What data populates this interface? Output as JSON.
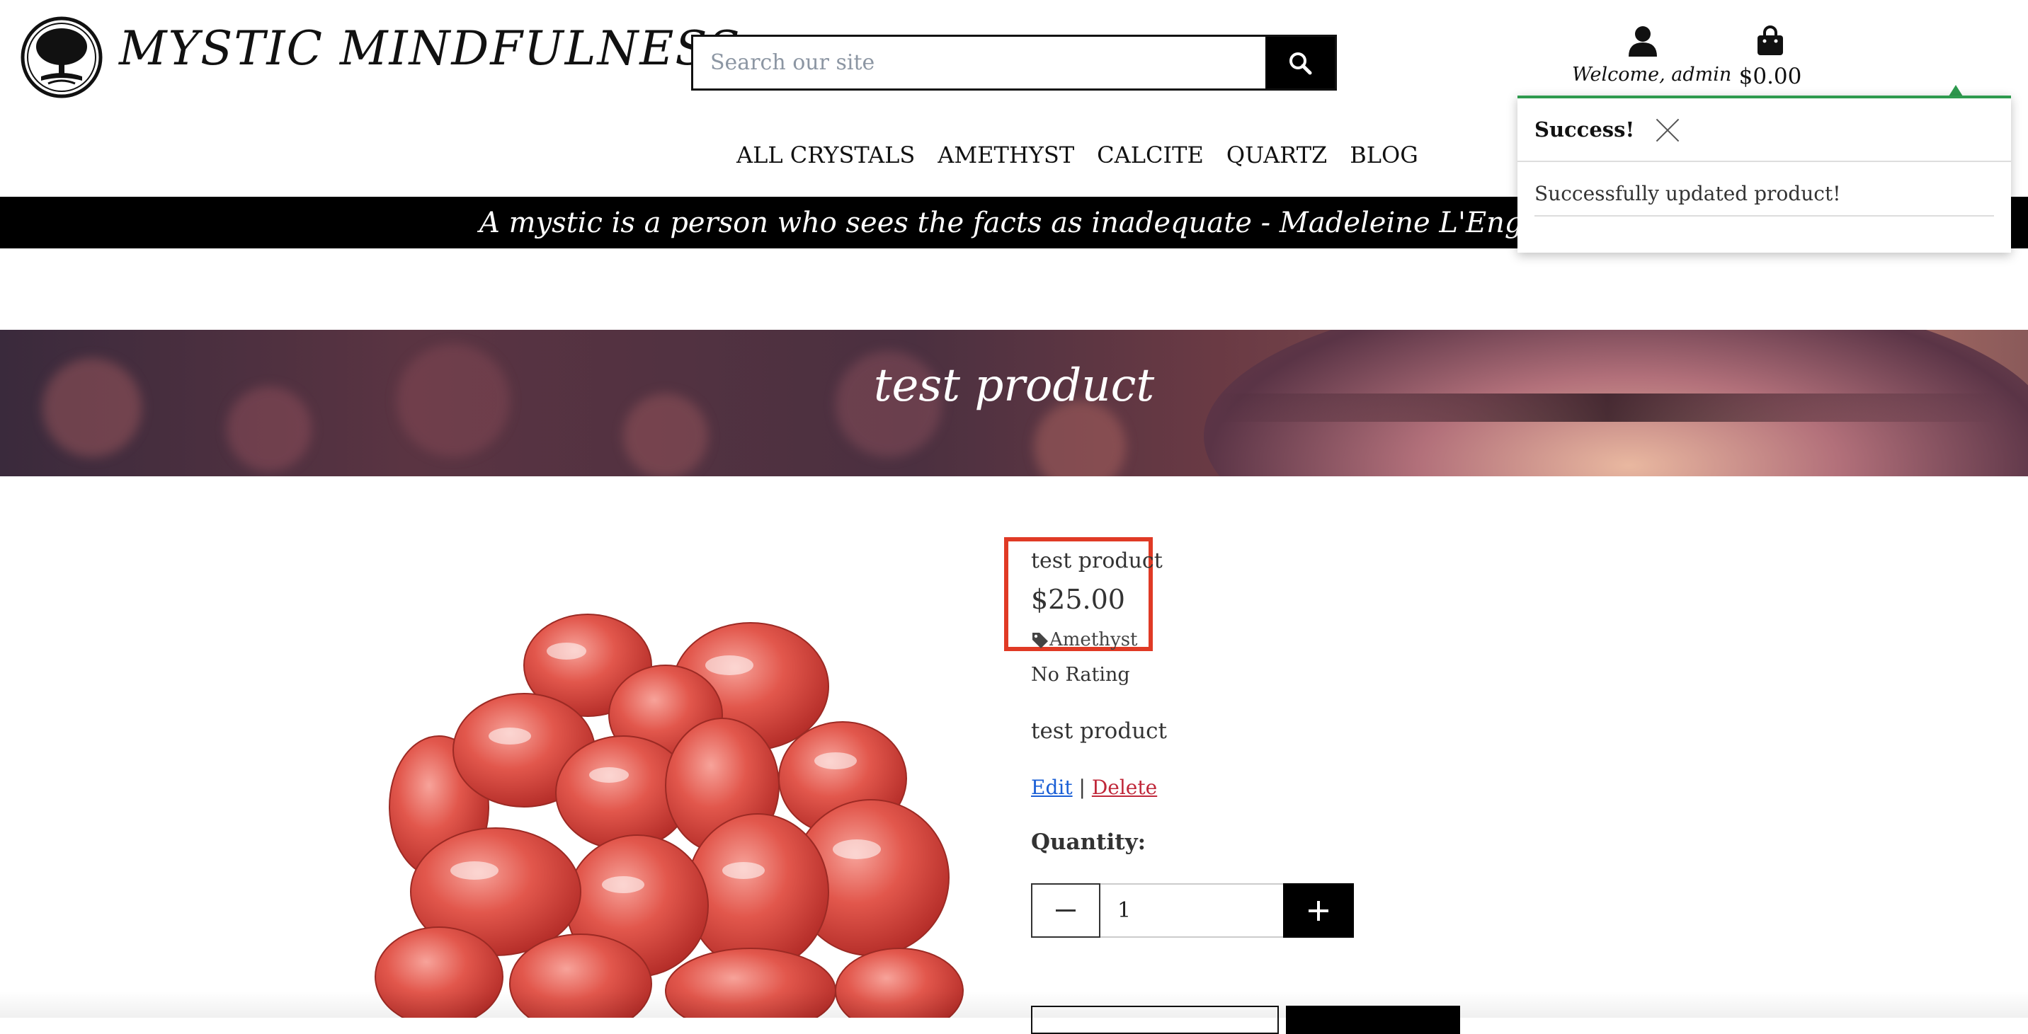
{
  "brand": {
    "name": "MYSTIC MINDFULNESS"
  },
  "search": {
    "placeholder": "Search our site"
  },
  "account": {
    "label": "Welcome, admin"
  },
  "cart": {
    "total": "$0.00"
  },
  "nav": {
    "items": [
      "ALL CRYSTALS",
      "AMETHYST",
      "CALCITE",
      "QUARTZ",
      "BLOG"
    ]
  },
  "quote": {
    "text": "A mystic is a person who sees the facts as inadequate - Madeleine L'Engle"
  },
  "toast": {
    "title": "Success!",
    "message": "Successfully updated product!",
    "accent": "#2e9a4e"
  },
  "hero": {
    "title": "test product"
  },
  "product": {
    "name": "test product",
    "price": "$25.00",
    "category": "Amethyst",
    "rating": "No Rating",
    "description": "test product",
    "edit_label": "Edit",
    "separator": "|",
    "delete_label": "Delete",
    "quantity_label": "Quantity:",
    "quantity_value": "1"
  },
  "colors": {
    "highlight": "#e03a25",
    "link": "#1a5fd6",
    "danger": "#c0283a"
  }
}
